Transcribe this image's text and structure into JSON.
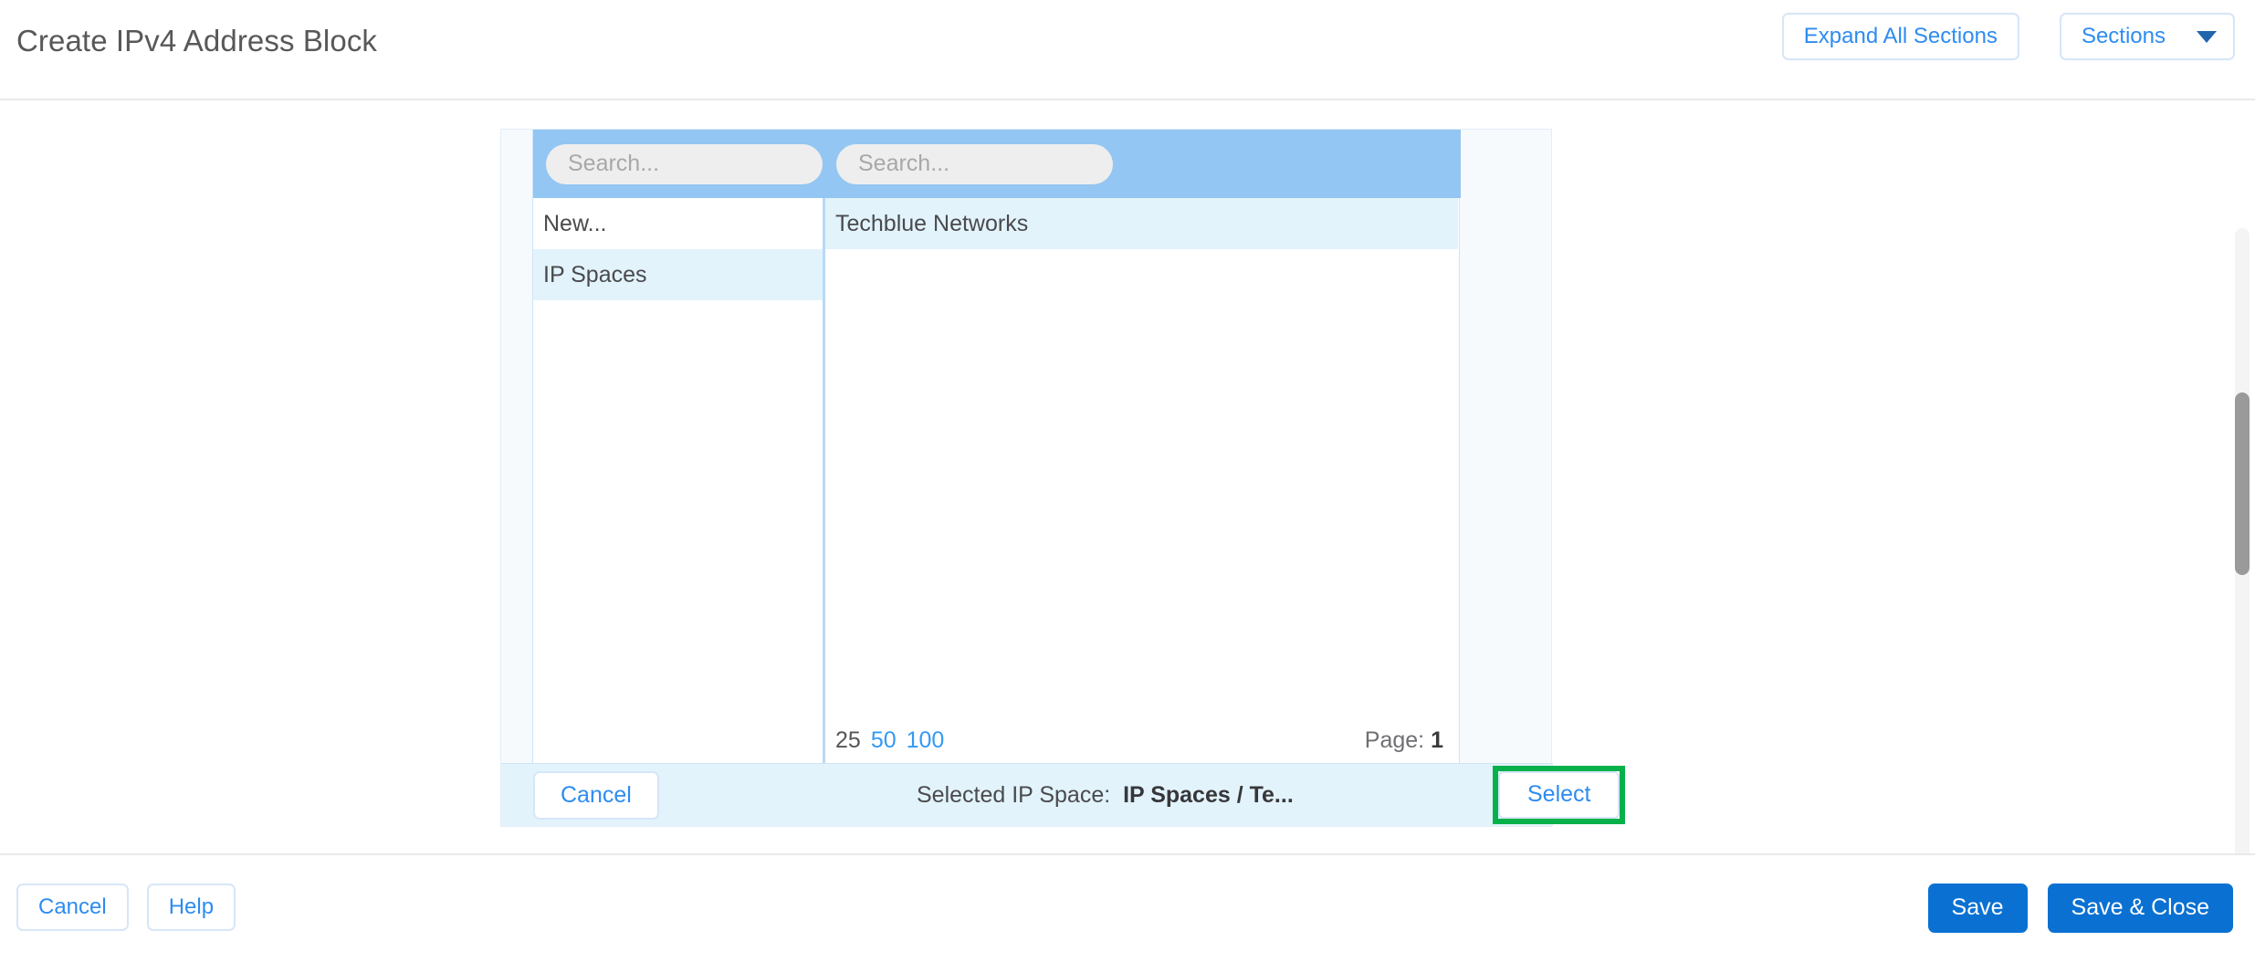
{
  "header": {
    "title": "Create IPv4 Address Block",
    "expand_all_label": "Expand All Sections",
    "sections_label": "Sections"
  },
  "picker": {
    "search_left": {
      "value": "",
      "placeholder": "Search..."
    },
    "search_right": {
      "value": "",
      "placeholder": "Search..."
    },
    "left_column": [
      {
        "label": "New...",
        "selected": false
      },
      {
        "label": "IP Spaces",
        "selected": true
      }
    ],
    "right_column": [
      {
        "label": "Techblue Networks",
        "selected": true
      }
    ],
    "pager": {
      "size_25": "25",
      "size_50": "50",
      "size_100": "100",
      "page_label": "Page:",
      "page_number": "1"
    },
    "footer": {
      "cancel_label": "Cancel",
      "selected_label": "Selected IP Space:",
      "selected_value": "IP Spaces / Te...",
      "select_label": "Select",
      "highlight_color": "#06b04a"
    }
  },
  "actions": {
    "cancel_label": "Cancel",
    "help_label": "Help",
    "save_label": "Save",
    "save_close_label": "Save & Close"
  },
  "colors": {
    "accent_blue": "#2d8cf0",
    "primary_blue": "#0a71d2",
    "band_blue": "#93c6f2",
    "selected_row": "#e2f3fc"
  }
}
